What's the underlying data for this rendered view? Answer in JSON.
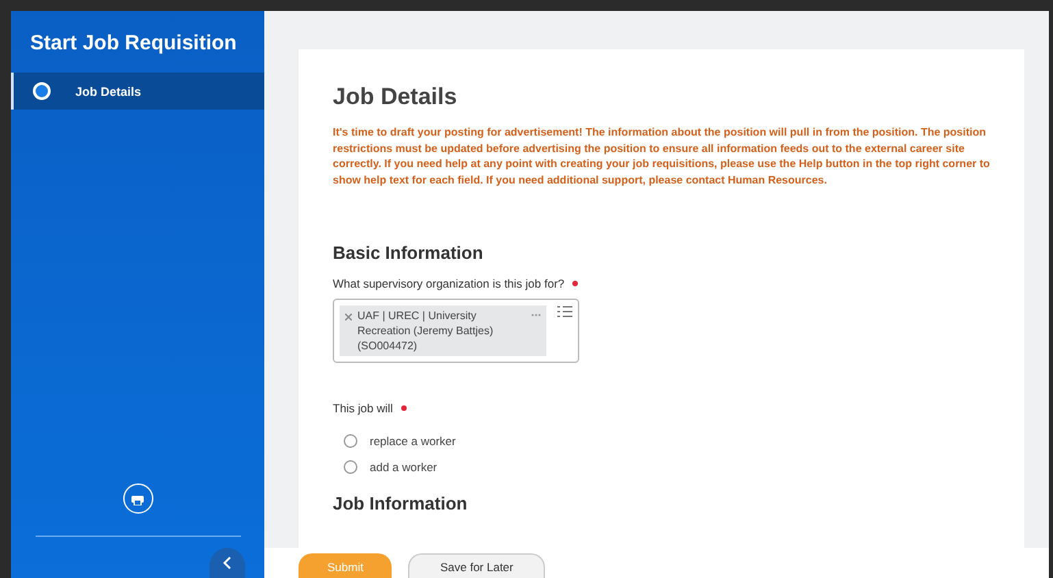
{
  "sidebar": {
    "title": "Start Job Requisition",
    "items": [
      {
        "label": "Job Details",
        "selected": true
      }
    ]
  },
  "card": {
    "title": "Job Details",
    "notice": "It's time to draft your posting for advertisement! The information about the position will pull in from the position. The position restrictions must be updated before advertising the position to ensure all information feeds out to the external career site correctly. If you need help at any point with creating your job requisitions, please use the Help button in the top right corner to show help text for each field. If you need additional support, please contact Human Resources.",
    "sections": [
      {
        "title": "Basic Information",
        "fields": [
          {
            "kind": "prompt",
            "label": "What supervisory organization is this job for?",
            "required": true,
            "value": "UAF | UREC | University Recreation (Jeremy Battjes) (SO004472)"
          },
          {
            "kind": "radio",
            "label": "This job will",
            "required": true,
            "options": [
              {
                "label": "replace a worker",
                "selected": false
              },
              {
                "label": "add a worker",
                "selected": false
              }
            ]
          }
        ]
      },
      {
        "title": "Job Information"
      }
    ]
  },
  "footer": {
    "buttons": [
      {
        "label": "Submit",
        "kind": "primary"
      },
      {
        "label": "Save for Later",
        "kind": "secondary"
      }
    ]
  }
}
